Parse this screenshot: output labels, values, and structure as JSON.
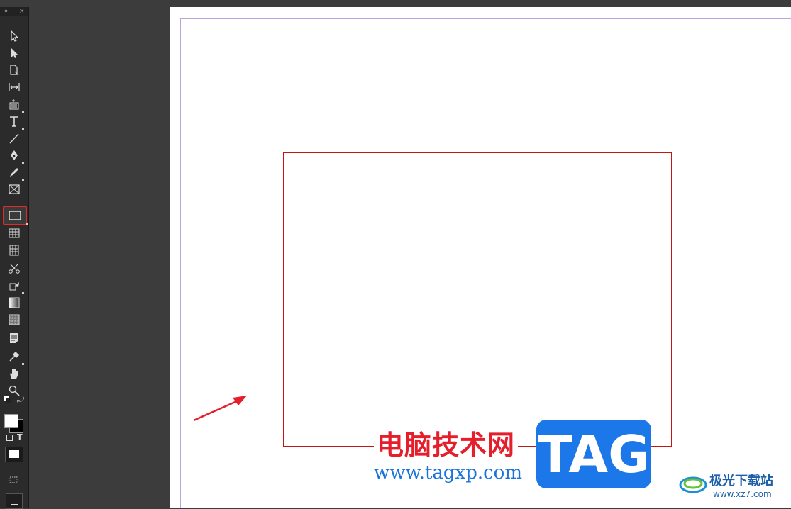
{
  "toolbar": {
    "tools": [
      {
        "name": "selection-tool"
      },
      {
        "name": "direct-selection-tool"
      },
      {
        "name": "page-tool"
      },
      {
        "name": "gap-tool"
      },
      {
        "name": "content-collector-tool"
      },
      {
        "name": "type-tool"
      },
      {
        "name": "line-tool"
      },
      {
        "name": "pen-tool"
      },
      {
        "name": "pencil-tool"
      },
      {
        "name": "rectangle-frame-tool"
      },
      {
        "name": "rectangle-tool",
        "selected": true
      },
      {
        "name": "horizontal-grid-tool"
      },
      {
        "name": "vertical-grid-tool"
      },
      {
        "name": "scissors-tool"
      },
      {
        "name": "free-transform-tool"
      },
      {
        "name": "gradient-swatch-tool"
      },
      {
        "name": "gradient-feather-tool"
      },
      {
        "name": "note-tool"
      },
      {
        "name": "eyedropper-tool"
      },
      {
        "name": "hand-tool"
      },
      {
        "name": "zoom-tool"
      }
    ],
    "format_text_label": "T"
  },
  "canvas": {
    "frame_color": "#c51616",
    "guide_color": "#b9a6e0"
  },
  "watermark": {
    "title": "电脑技术网",
    "url": "www.tagxp.com",
    "logo_text": "TAG",
    "site_name": "极光下载站",
    "site_url": "www.xz7.com"
  },
  "colors": {
    "toolbar_bg": "#2b2b2b",
    "pasteboard_bg": "#3c3c3c",
    "highlight": "#e02a2a",
    "watermark_red": "#e51e2c",
    "watermark_blue": "#1a73d9",
    "logo_blue": "#1c78e8"
  }
}
